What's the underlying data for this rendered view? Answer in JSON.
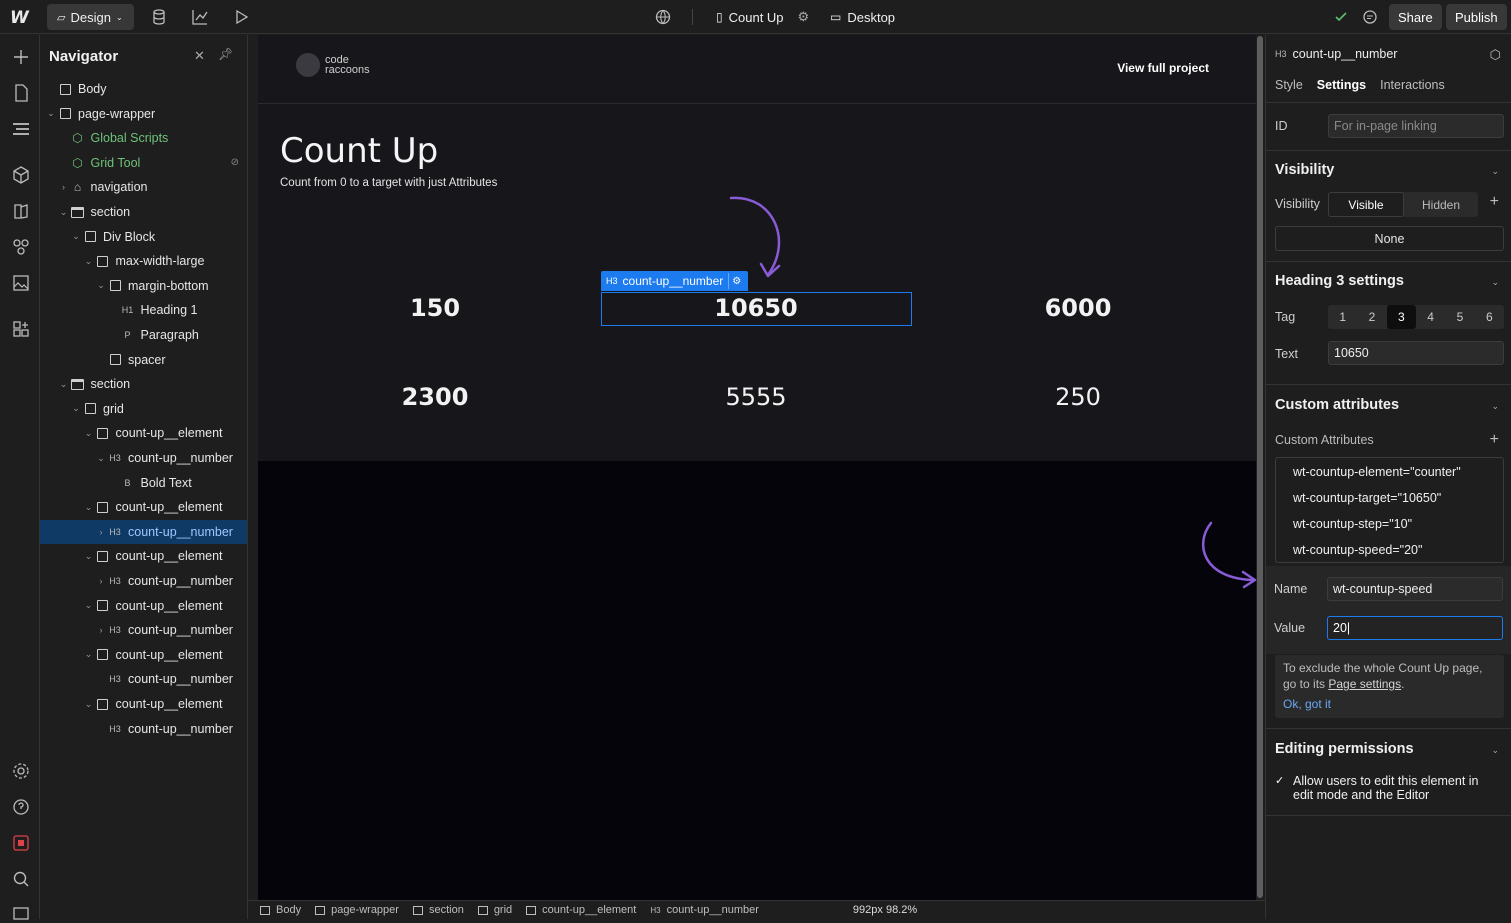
{
  "topbar": {
    "logo": "W",
    "mode": "Design",
    "page_name": "Count Up",
    "breakpoint": "Desktop",
    "share": "Share",
    "publish": "Publish"
  },
  "navigator": {
    "title": "Navigator",
    "items": [
      {
        "label": "Body",
        "tag": "",
        "caret": ""
      },
      {
        "label": "page-wrapper",
        "tag": "",
        "caret": "v"
      },
      {
        "label": "Global Scripts",
        "tag": "",
        "caret": ""
      },
      {
        "label": "Grid Tool",
        "tag": "",
        "caret": ""
      },
      {
        "label": "navigation",
        "tag": "",
        "caret": ">"
      },
      {
        "label": "section",
        "tag": "",
        "caret": "v"
      },
      {
        "label": "Div Block",
        "tag": "",
        "caret": "v"
      },
      {
        "label": "max-width-large",
        "tag": "",
        "caret": "v"
      },
      {
        "label": "margin-bottom",
        "tag": "",
        "caret": "v"
      },
      {
        "label": "Heading 1",
        "tag": "H1",
        "caret": ""
      },
      {
        "label": "Paragraph",
        "tag": "P",
        "caret": ""
      },
      {
        "label": "spacer",
        "tag": "",
        "caret": ""
      },
      {
        "label": "section",
        "tag": "",
        "caret": "v"
      },
      {
        "label": "grid",
        "tag": "",
        "caret": "v"
      },
      {
        "label": "count-up__element",
        "tag": "",
        "caret": "v"
      },
      {
        "label": "count-up__number",
        "tag": "H3",
        "caret": "v"
      },
      {
        "label": "Bold Text",
        "tag": "B",
        "caret": ""
      },
      {
        "label": "count-up__element",
        "tag": "",
        "caret": "v"
      },
      {
        "label": "count-up__number",
        "tag": "H3",
        "caret": ">"
      },
      {
        "label": "count-up__element",
        "tag": "",
        "caret": "v"
      },
      {
        "label": "count-up__number",
        "tag": "H3",
        "caret": ">"
      },
      {
        "label": "count-up__element",
        "tag": "",
        "caret": "v"
      },
      {
        "label": "count-up__number",
        "tag": "H3",
        "caret": ">"
      },
      {
        "label": "count-up__element",
        "tag": "",
        "caret": "v"
      },
      {
        "label": "count-up__number",
        "tag": "H3",
        "caret": ""
      },
      {
        "label": "count-up__element",
        "tag": "",
        "caret": "v"
      },
      {
        "label": "count-up__number",
        "tag": "H3",
        "caret": ""
      }
    ]
  },
  "canvas": {
    "logo_line1": "code",
    "logo_line2": "raccoons",
    "view_link": "View full project",
    "heading": "Count Up",
    "paragraph": "Count from 0 to a target with just Attributes",
    "counts": [
      "150",
      "10650",
      "6000",
      "2300",
      "5555",
      "250"
    ],
    "selected_tag": "H3",
    "selected_label": "count-up__number"
  },
  "breadcrumbs": {
    "items": [
      "Body",
      "page-wrapper",
      "section",
      "grid",
      "count-up__element",
      "count-up__number"
    ],
    "size": "992px 98.2%"
  },
  "panel": {
    "element_tag": "H3",
    "element_name": "count-up__number",
    "tabs": [
      "Style",
      "Settings",
      "Interactions"
    ],
    "id_label": "ID",
    "id_placeholder": "For in-page linking",
    "visibility_title": "Visibility",
    "visibility_label": "Visibility",
    "visible": "Visible",
    "hidden": "Hidden",
    "none": "None",
    "heading_settings_title": "Heading 3 settings",
    "tag_label": "Tag",
    "tags": [
      "1",
      "2",
      "3",
      "4",
      "5",
      "6"
    ],
    "text_label": "Text",
    "text_value": "10650",
    "custom_attr_title": "Custom attributes",
    "custom_attr_label": "Custom Attributes",
    "attributes": [
      "wt-countup-element=\"counter\"",
      "wt-countup-target=\"10650\"",
      "wt-countup-step=\"10\"",
      "wt-countup-speed=\"20\""
    ],
    "name_label": "Name",
    "name_value": "wt-countup-speed",
    "value_label": "Value",
    "value_value": "20",
    "tip_text": "To exclude the whole Count Up page, go to its",
    "tip_link": "Page settings",
    "tip_ok": "Ok, got it",
    "editing_title": "Editing permissions",
    "perm_text": "Allow users to edit this element in edit mode and the Editor"
  }
}
